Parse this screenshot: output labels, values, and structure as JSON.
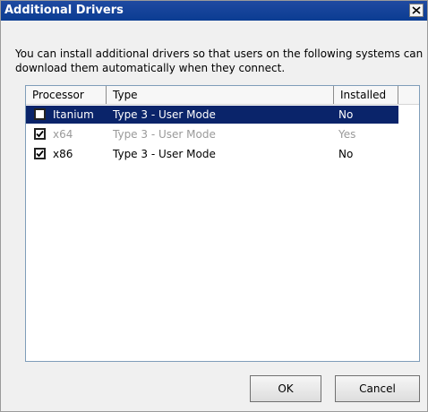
{
  "window": {
    "title": "Additional Drivers",
    "close_icon": "close-icon"
  },
  "description": "You can install additional drivers so that users on the following systems can download them automatically when they connect.",
  "list": {
    "columns": [
      "Processor",
      "Type",
      "Installed"
    ],
    "rows": [
      {
        "processor": "Itanium",
        "type": "Type 3 - User Mode",
        "installed": "No",
        "checked": false,
        "selected": true,
        "disabled": false
      },
      {
        "processor": "x64",
        "type": "Type 3 - User Mode",
        "installed": "Yes",
        "checked": true,
        "selected": false,
        "disabled": true
      },
      {
        "processor": "x86",
        "type": "Type 3 - User Mode",
        "installed": "No",
        "checked": true,
        "selected": false,
        "disabled": false
      }
    ]
  },
  "buttons": {
    "ok": "OK",
    "cancel": "Cancel"
  },
  "colors": {
    "title_bar": "#1f4aa1",
    "selection": "#0a246a",
    "disabled_text": "#9a9a9a"
  }
}
